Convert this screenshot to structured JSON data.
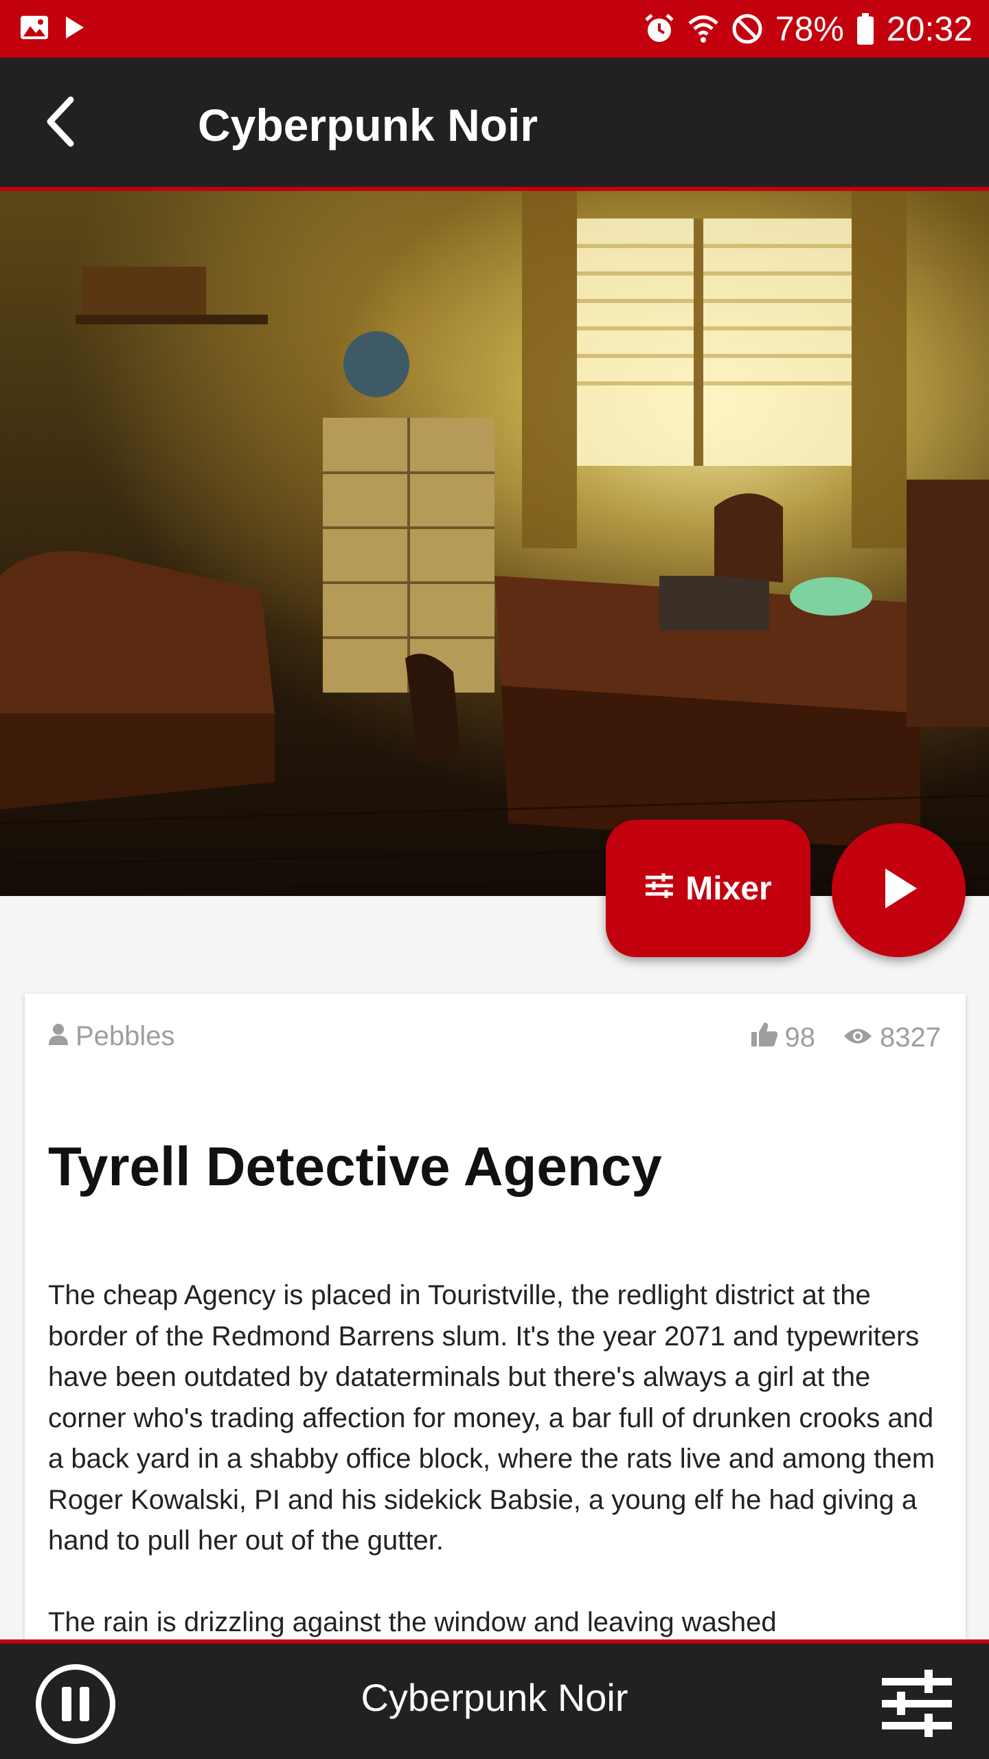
{
  "status_bar": {
    "left_icons": [
      "image-icon",
      "play-store-icon"
    ],
    "right_icons": [
      "alarm-icon",
      "wifi-icon",
      "do-not-disturb-icon",
      "battery-icon"
    ],
    "battery": "78%",
    "time": "20:32"
  },
  "app_bar": {
    "title": "Cyberpunk Noir",
    "back_icon": "chevron-left-icon"
  },
  "hero": {
    "mixer_label": "Mixer",
    "mixer_icon": "sliders-icon",
    "play_icon": "play-icon"
  },
  "card": {
    "author": "Pebbles",
    "likes": "98",
    "views": "8327",
    "title": "Tyrell Detective Agency",
    "paragraphs": [
      "The cheap Agency is placed in Touristville, the redlight district at the border of the Redmond Barrens slum. It's the year 2071 and typewriters have been outdated by dataterminals but there's always a girl at the corner who's trading affection for money, a bar full of drunken crooks and a back yard in a shabby office block, where the rats live and among them Roger Kowalski, PI and his sidekick Babsie, a young elf he had giving a hand to pull her out of the gutter.",
      "The rain is drizzling against the window and leaving washed"
    ]
  },
  "player": {
    "title": "Cyberpunk Noir",
    "pause_icon": "pause-icon",
    "mixer_icon": "equalizer-icon"
  },
  "colors": {
    "accent": "#c3000e",
    "dark": "#212121"
  }
}
